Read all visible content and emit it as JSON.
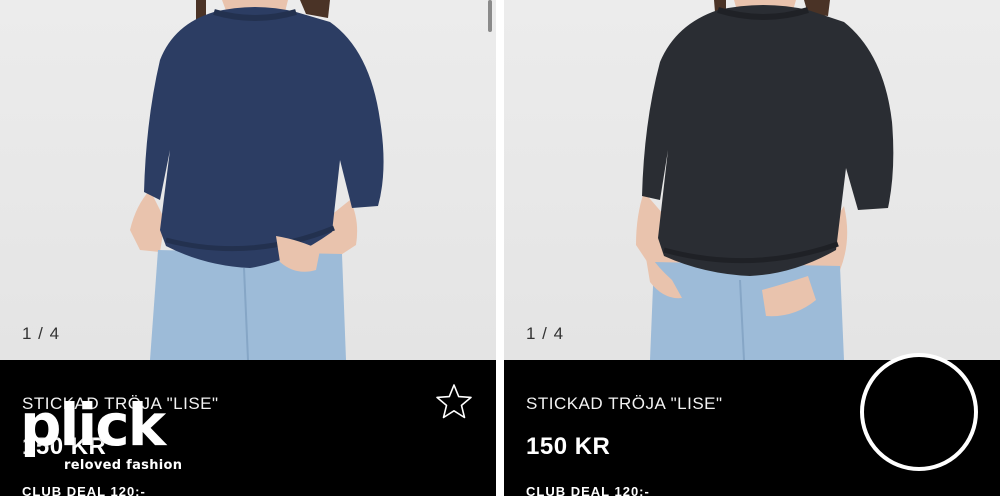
{
  "products": [
    {
      "counter": "1 / 4",
      "title": "STICKAD TRÖJA \"LISE\"",
      "price": "150 KR",
      "club_deal": "CLUB DEAL 120:-",
      "sweater_color": "#2c3d63",
      "favorite_icon": "star-outline-icon"
    },
    {
      "counter": "1 / 4",
      "title": "STICKAD TRÖJA \"LISE\"",
      "price": "150 KR",
      "club_deal": "CLUB DEAL 120:-",
      "sweater_color": "#2a2d33"
    }
  ],
  "overlay": {
    "logo_word": "plick",
    "logo_tagline": "reloved fashion"
  },
  "colors": {
    "info_background": "#000000",
    "photo_background": "#e8e8e8",
    "jeans": "#9dbbd8",
    "skin": "#e9c3ad"
  }
}
